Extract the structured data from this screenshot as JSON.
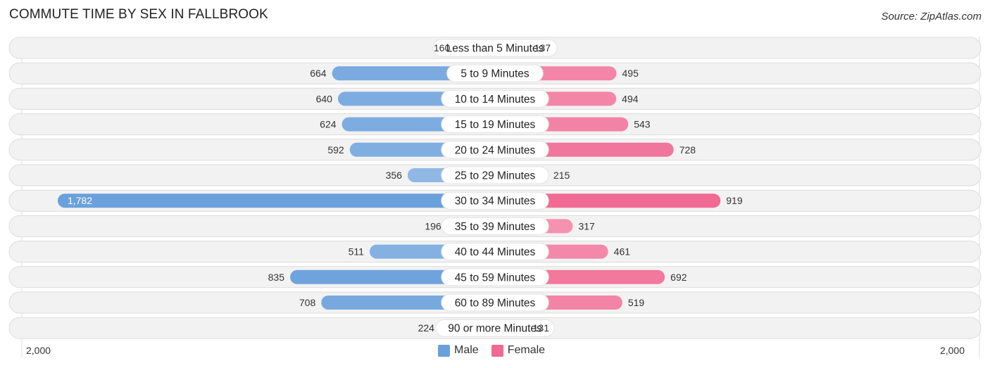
{
  "header": {
    "title": "COMMUTE TIME BY SEX IN FALLBROOK",
    "source": "Source: ZipAtlas.com"
  },
  "colors": {
    "male": "#6aa0dc",
    "male_light": "#a9c8eb",
    "female": "#f06a94",
    "female_light": "#f7a8c1",
    "track": "#f2f2f2"
  },
  "chart_data": {
    "type": "bar",
    "orientation": "horizontal-diverging",
    "title": "COMMUTE TIME BY SEX IN FALLBROOK",
    "categories": [
      "Less than 5 Minutes",
      "5 to 9 Minutes",
      "10 to 14 Minutes",
      "15 to 19 Minutes",
      "20 to 24 Minutes",
      "25 to 29 Minutes",
      "30 to 34 Minutes",
      "35 to 39 Minutes",
      "40 to 44 Minutes",
      "45 to 59 Minutes",
      "60 to 89 Minutes",
      "90 or more Minutes"
    ],
    "series": [
      {
        "name": "Male",
        "side": "left",
        "values": [
          160,
          664,
          640,
          624,
          592,
          356,
          1782,
          196,
          511,
          835,
          708,
          224
        ],
        "labels": [
          "160",
          "664",
          "640",
          "624",
          "592",
          "356",
          "1,782",
          "196",
          "511",
          "835",
          "708",
          "224"
        ]
      },
      {
        "name": "Female",
        "side": "right",
        "values": [
          137,
          495,
          494,
          543,
          728,
          215,
          919,
          317,
          461,
          692,
          519,
          131
        ],
        "labels": [
          "137",
          "495",
          "494",
          "543",
          "728",
          "215",
          "919",
          "317",
          "461",
          "692",
          "519",
          "131"
        ]
      }
    ],
    "xlim": [
      -2000,
      2000
    ],
    "axis_labels": {
      "left": "2,000",
      "right": "2,000"
    },
    "legend": {
      "position": "bottom-center",
      "entries": [
        "Male",
        "Female"
      ]
    },
    "grid": false
  }
}
